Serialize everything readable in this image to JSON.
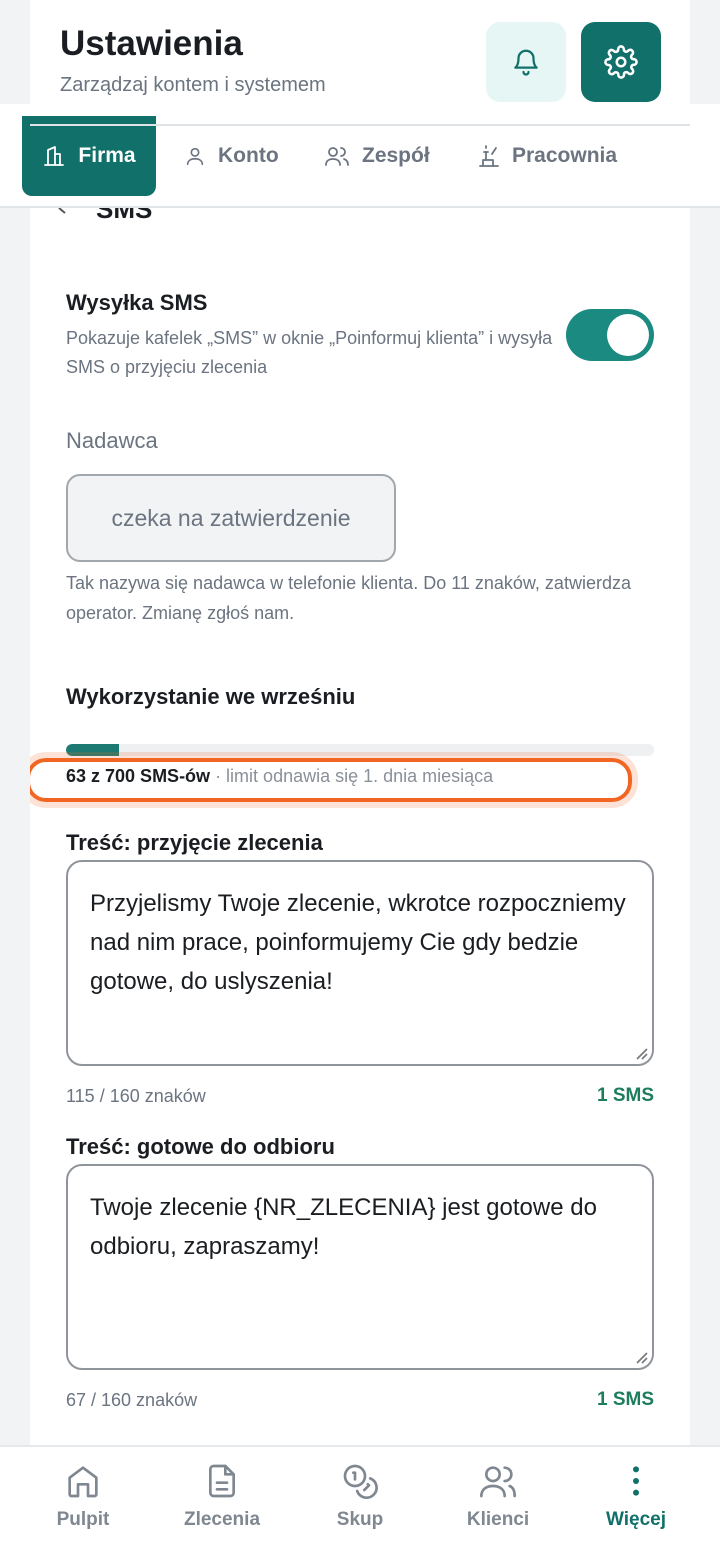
{
  "header": {
    "title": "Ustawienia",
    "subtitle": "Zarządzaj kontem i systemem",
    "bell_icon": "bell-icon",
    "gear_icon": "gear-icon"
  },
  "tabs": [
    {
      "label": "Firma",
      "icon": "building-icon",
      "active": true
    },
    {
      "label": "Konto",
      "icon": "user-icon"
    },
    {
      "label": "Zespół",
      "icon": "users-icon"
    },
    {
      "label": "Pracownia",
      "icon": "workshop-icon"
    }
  ],
  "sms": {
    "section_title": "SMS",
    "toggle_title": "Wysyłka SMS",
    "toggle_desc": "Pokazuje kafelek „SMS” w oknie „Poinformuj klienta” i wysyła SMS o przyjęciu zlecenia",
    "toggle_on": true,
    "sender_label": "Nadawca",
    "sender_value": "czeka na zatwierdzenie",
    "sender_help": "Tak nazywa się nadawca w telefonie klienta. Do 11 znaków, zatwierdza operator. Zmianę zgłoś nam.",
    "usage_title": "Wykorzystanie we wrześniu",
    "usage_used_text": "63 z 700 SMS-ów",
    "usage_rest_text": " · limit odnawia się 1. dnia miesiąca",
    "usage_used": 63,
    "usage_limit": 700
  },
  "templates": [
    {
      "title": "Treść: przyjęcie zlecenia",
      "text": "Przyjelismy Twoje zlecenie, wkrotce rozpoczniemy nad nim prace, poinformujemy Cie gdy bedzie gotowe, do uslyszenia!",
      "count": "115 / 160 znaków",
      "sms": "1 SMS"
    },
    {
      "title": "Treść: gotowe do odbioru",
      "text": "Twoje zlecenie {NR_ZLECENIA} jest gotowe do odbioru, zapraszamy!",
      "count": "67 / 160 znaków",
      "sms": "1 SMS"
    }
  ],
  "bottom_nav": [
    {
      "label": "Pulpit",
      "icon": "home-icon"
    },
    {
      "label": "Zlecenia",
      "icon": "document-icon"
    },
    {
      "label": "Skup",
      "icon": "coins-icon"
    },
    {
      "label": "Klienci",
      "icon": "users-icon"
    },
    {
      "label": "Więcej",
      "icon": "more-vertical-icon",
      "active": true
    }
  ],
  "colors": {
    "brand": "#11706a",
    "toggle": "#1b8a80",
    "highlight": "#f26522",
    "sms_count": "#1e7d5c"
  }
}
